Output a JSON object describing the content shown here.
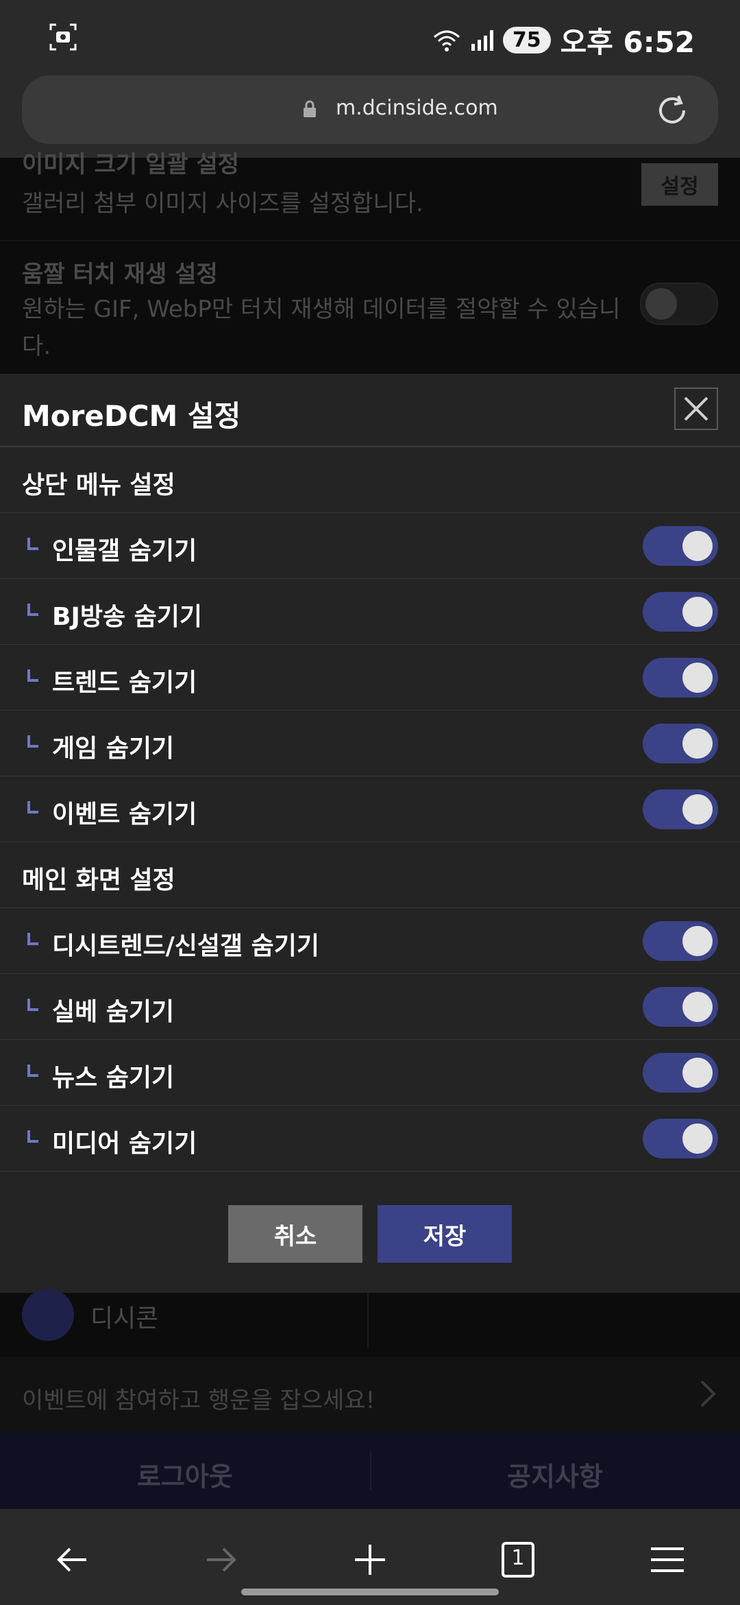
{
  "status_bar": {
    "time": "오후 6:52",
    "battery": "75"
  },
  "browser": {
    "url": "m.dcinside.com",
    "tab_count": "1"
  },
  "background": {
    "image_size_title": "이미지 크기 일괄 설정",
    "image_size_desc": "갤러리 첨부 이미지 사이즈를 설정합니다.",
    "image_size_button": "설정",
    "gif_title": "움짤 터치 재생 설정",
    "gif_desc": "원하는 GIF, WebP만 터치 재생해 데이터를 절약할 수 있습니다.",
    "dicon_label": "디시콘",
    "event_banner": "이벤트에 참여하고 행운을 잡으세요!",
    "logout": "로그아웃",
    "notice": "공지사항"
  },
  "modal": {
    "title": "MoreDCM 설정",
    "section_top": "상단 메뉴 설정",
    "top_items": [
      {
        "label": "인물갤 숨기기",
        "enabled": true
      },
      {
        "label": "BJ방송 숨기기",
        "enabled": true
      },
      {
        "label": "트렌드 숨기기",
        "enabled": true
      },
      {
        "label": "게임 숨기기",
        "enabled": true
      },
      {
        "label": "이벤트 숨기기",
        "enabled": true
      }
    ],
    "section_main": "메인 화면 설정",
    "main_items": [
      {
        "label": "디시트렌드/신설갤 숨기기",
        "enabled": true
      },
      {
        "label": "실베 숨기기",
        "enabled": true
      },
      {
        "label": "뉴스 숨기기",
        "enabled": true
      },
      {
        "label": "미디어 숨기기",
        "enabled": true
      }
    ],
    "cancel": "취소",
    "save": "저장"
  },
  "colors": {
    "accent": "#3b4287",
    "corner_mark": "#6f78c8",
    "modal_bg": "#242424"
  }
}
